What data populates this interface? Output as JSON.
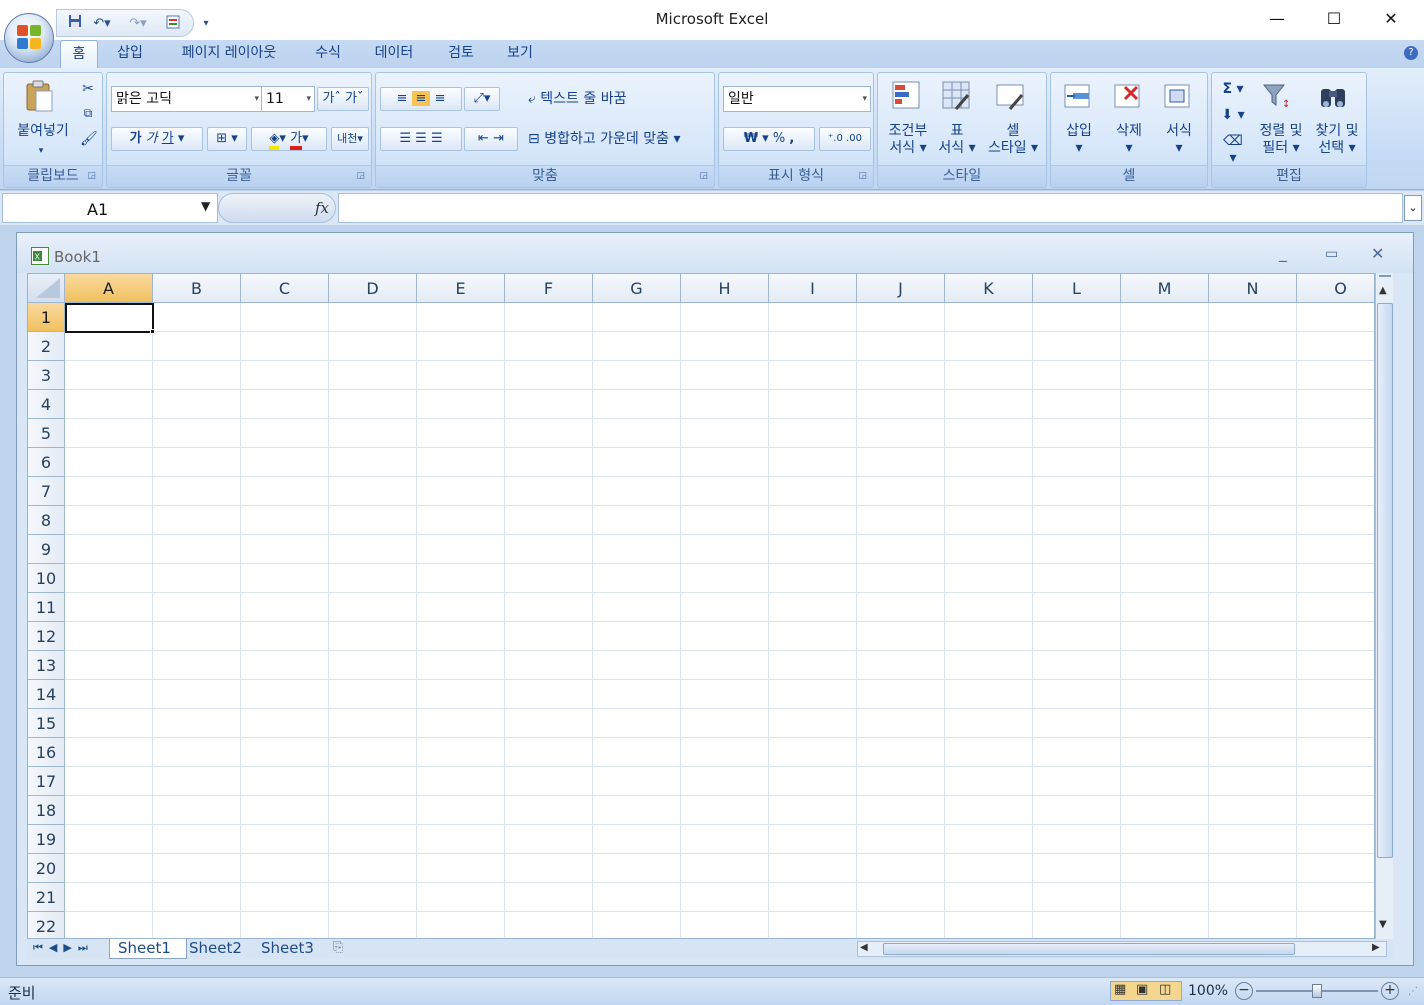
{
  "app": {
    "title": "Microsoft Excel"
  },
  "window_controls": {
    "minimize": "—",
    "maximize": "☐",
    "close": "✕"
  },
  "tabs": [
    {
      "label": "홈",
      "active": true
    },
    {
      "label": "삽입"
    },
    {
      "label": "페이지 레이아웃"
    },
    {
      "label": "수식"
    },
    {
      "label": "데이터"
    },
    {
      "label": "검토"
    },
    {
      "label": "보기"
    }
  ],
  "ribbon": {
    "clipboard": {
      "label": "클립보드",
      "paste": "붙여넣기"
    },
    "font": {
      "label": "글꼴",
      "font_name": "맑은 고딕",
      "font_size": "11",
      "grow": "가",
      "shrink": "가",
      "bold": "가",
      "italic": "가",
      "underline": "가",
      "font_color_glyph": "가",
      "phonetic": "내천"
    },
    "alignment": {
      "label": "맞춤",
      "wrap_text": "텍스트 줄 바꿈",
      "merge_center": "병합하고 가운데 맞춤"
    },
    "number": {
      "label": "표시 형식",
      "format": "일반",
      "currency": "₩",
      "percent": "%",
      "comma": ","
    },
    "styles": {
      "label": "스타일",
      "conditional": [
        "조건부",
        "서식"
      ],
      "table": [
        "표",
        "서식"
      ],
      "cell": [
        "셀",
        "스타일"
      ]
    },
    "cells": {
      "label": "셀",
      "insert": "삽입",
      "delete": "삭제",
      "format": "서식"
    },
    "editing": {
      "label": "편집",
      "sort": [
        "정렬 및",
        "필터"
      ],
      "find": [
        "찾기 및",
        "선택"
      ],
      "sum": "Σ"
    }
  },
  "formula_bar": {
    "name_box": "A1",
    "fx": "fx",
    "value": ""
  },
  "workbook": {
    "title": "Book1"
  },
  "grid": {
    "columns": [
      "A",
      "B",
      "C",
      "D",
      "E",
      "F",
      "G",
      "H",
      "I",
      "J",
      "K",
      "L",
      "M",
      "N",
      "O"
    ],
    "rows": [
      "1",
      "2",
      "3",
      "4",
      "5",
      "6",
      "7",
      "8",
      "9",
      "10",
      "11",
      "12",
      "13",
      "14",
      "15",
      "16",
      "17",
      "18",
      "19",
      "20",
      "21",
      "22"
    ],
    "selected_cell": "A1"
  },
  "sheets": [
    {
      "name": "Sheet1",
      "active": true
    },
    {
      "name": "Sheet2"
    },
    {
      "name": "Sheet3"
    }
  ],
  "status": {
    "text": "준비",
    "zoom": "100%"
  },
  "colors": {
    "accent": "#15428b",
    "ribbon": "#c6dbf5",
    "selection_header": "#f1c15f"
  }
}
